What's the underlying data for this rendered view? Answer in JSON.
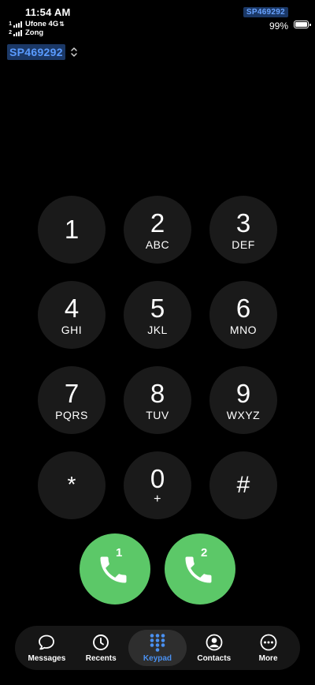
{
  "status_bar": {
    "time": "11:54 AM",
    "sim1": {
      "index": "1",
      "carrier": "Ufone 4G",
      "data_arrows": "⇅"
    },
    "sim2": {
      "index": "2",
      "carrier": "Zong"
    },
    "sim_pill": "SP469292",
    "battery_pct": "99%",
    "battery_level": 0.99
  },
  "line_selector": {
    "label": "SP469292",
    "icon": "chevron-updown-icon"
  },
  "keypad": {
    "keys": [
      {
        "digit": "1",
        "letters": ""
      },
      {
        "digit": "2",
        "letters": "ABC"
      },
      {
        "digit": "3",
        "letters": "DEF"
      },
      {
        "digit": "4",
        "letters": "GHI"
      },
      {
        "digit": "5",
        "letters": "JKL"
      },
      {
        "digit": "6",
        "letters": "MNO"
      },
      {
        "digit": "7",
        "letters": "PQRS"
      },
      {
        "digit": "8",
        "letters": "TUV"
      },
      {
        "digit": "9",
        "letters": "WXYZ"
      },
      {
        "digit": "*",
        "letters": ""
      },
      {
        "digit": "0",
        "letters": "+"
      },
      {
        "digit": "#",
        "letters": ""
      }
    ]
  },
  "call_buttons": [
    {
      "sim": "1",
      "icon": "phone-icon",
      "color": "#5cc868"
    },
    {
      "sim": "2",
      "icon": "phone-icon",
      "color": "#5cc868"
    }
  ],
  "tab_bar": {
    "tabs": [
      {
        "label": "Messages",
        "icon": "message-bubble-icon",
        "active": false
      },
      {
        "label": "Recents",
        "icon": "clock-icon",
        "active": false
      },
      {
        "label": "Keypad",
        "icon": "keypad-grid-icon",
        "active": true
      },
      {
        "label": "Contacts",
        "icon": "person-circle-icon",
        "active": false
      },
      {
        "label": "More",
        "icon": "ellipsis-circle-icon",
        "active": false
      }
    ],
    "active_color": "#4a90f0"
  },
  "colors": {
    "background": "#000000",
    "key_background": "#1a1a1a",
    "call_green": "#5cc868",
    "sim_label_bg": "#1b3866",
    "sim_label_text": "#5a9bff"
  }
}
